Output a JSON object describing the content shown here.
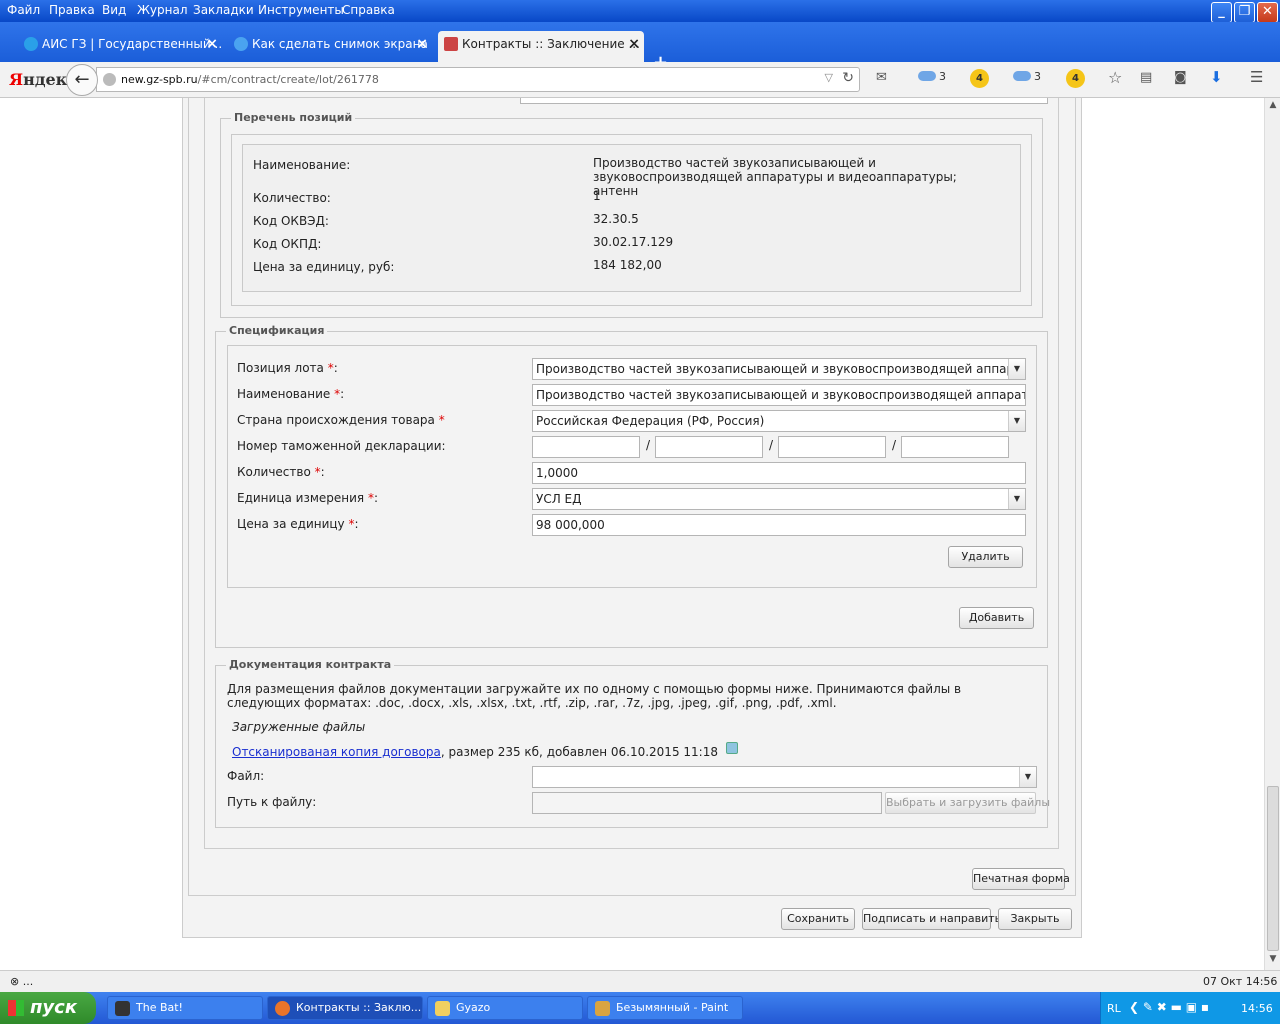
{
  "menu": [
    "Файл",
    "Правка",
    "Вид",
    "Журнал",
    "Закладки",
    "Инструменты",
    "Справка"
  ],
  "tabs": [
    {
      "label": "АИС ГЗ | Государственный ..."
    },
    {
      "label": "Как сделать снимок экрана ..."
    },
    {
      "label": "Контракты :: Заключение ..."
    }
  ],
  "nav": {
    "logo_first": "Я",
    "logo_rest": "ндекс",
    "url_domain": "new.gz-spb.ru",
    "url_path": "/#cm/contract/create/lot/261778",
    "weather1": "3",
    "badge1": "4",
    "weather2": "3",
    "badge2": "4"
  },
  "positions": {
    "legend": "Перечень позиций",
    "name_label": "Наименование:",
    "name_value": "Производство частей звукозаписывающей и звуковоспроизводящей аппаратуры и видеоаппаратуры; антенн",
    "qty_label": "Количество:",
    "qty_value": "1",
    "okved_label": "Код ОКВЭД:",
    "okved_value": "32.30.5",
    "okpd_label": "Код ОКПД:",
    "okpd_value": "30.02.17.129",
    "price_label": "Цена за единицу, руб:",
    "price_value": "184 182,00"
  },
  "spec": {
    "legend": "Спецификация",
    "lot_label": "Позиция лота",
    "lot_value": "Производство частей звукозаписывающей и звуковоспроизводящей аппаратуры и",
    "name_label": "Наименование",
    "name_value": "Производство частей звукозаписывающей и звуковоспроизводящей аппаратуры и ви,",
    "country_label": "Страна происхождения товара",
    "country_value": "Российская Федерация (РФ, Россия)",
    "customs_label": "Номер таможенной декларации:",
    "qty_label": "Количество",
    "qty_value": "1,0000",
    "unit_label": "Единица измерения",
    "unit_value": "УСЛ ЕД",
    "price_label": "Цена за единицу",
    "price_value": "98 000,000",
    "delete_btn": "Удалить",
    "add_btn": "Добавить",
    "star": "*",
    "colon": ":"
  },
  "docs": {
    "legend": "Документация контракта",
    "info": "Для размещения файлов документации загружайте их по одному с помощью формы ниже. Принимаются файлы в следующих форматах: .doc, .docx, .xls, .xlsx, .txt, .rtf, .zip, .rar, .7z, .jpg, .jpeg, .gif, .png, .pdf, .xml.",
    "uploaded_title": "Загруженные файлы",
    "file_link": "Отсканированая копия договора",
    "file_meta": ", размер 235 кб, добавлен 06.10.2015 11:18",
    "file_label": "Файл:",
    "path_label": "Путь к файлу:",
    "upload_btn": "Выбрать и загрузить файлы"
  },
  "actions": {
    "print_btn": "Печатная форма",
    "save_btn": "Сохранить",
    "sign_btn": "Подписать и направить",
    "close_btn": "Закрыть"
  },
  "status": {
    "left": "⊗ ...",
    "datetime": "07 Окт 14:56"
  },
  "taskbar": {
    "start": "пуск",
    "tasks": [
      "The Bat!",
      "Контракты :: Заклю...",
      "Gyazo",
      "Безымянный - Paint"
    ],
    "lang": "RL",
    "clock": "14:56"
  },
  "colors": {
    "xp_blue": "#2358d4",
    "start_green": "#3a9a33",
    "required": "#dd0000",
    "link": "#1a2fd0"
  }
}
